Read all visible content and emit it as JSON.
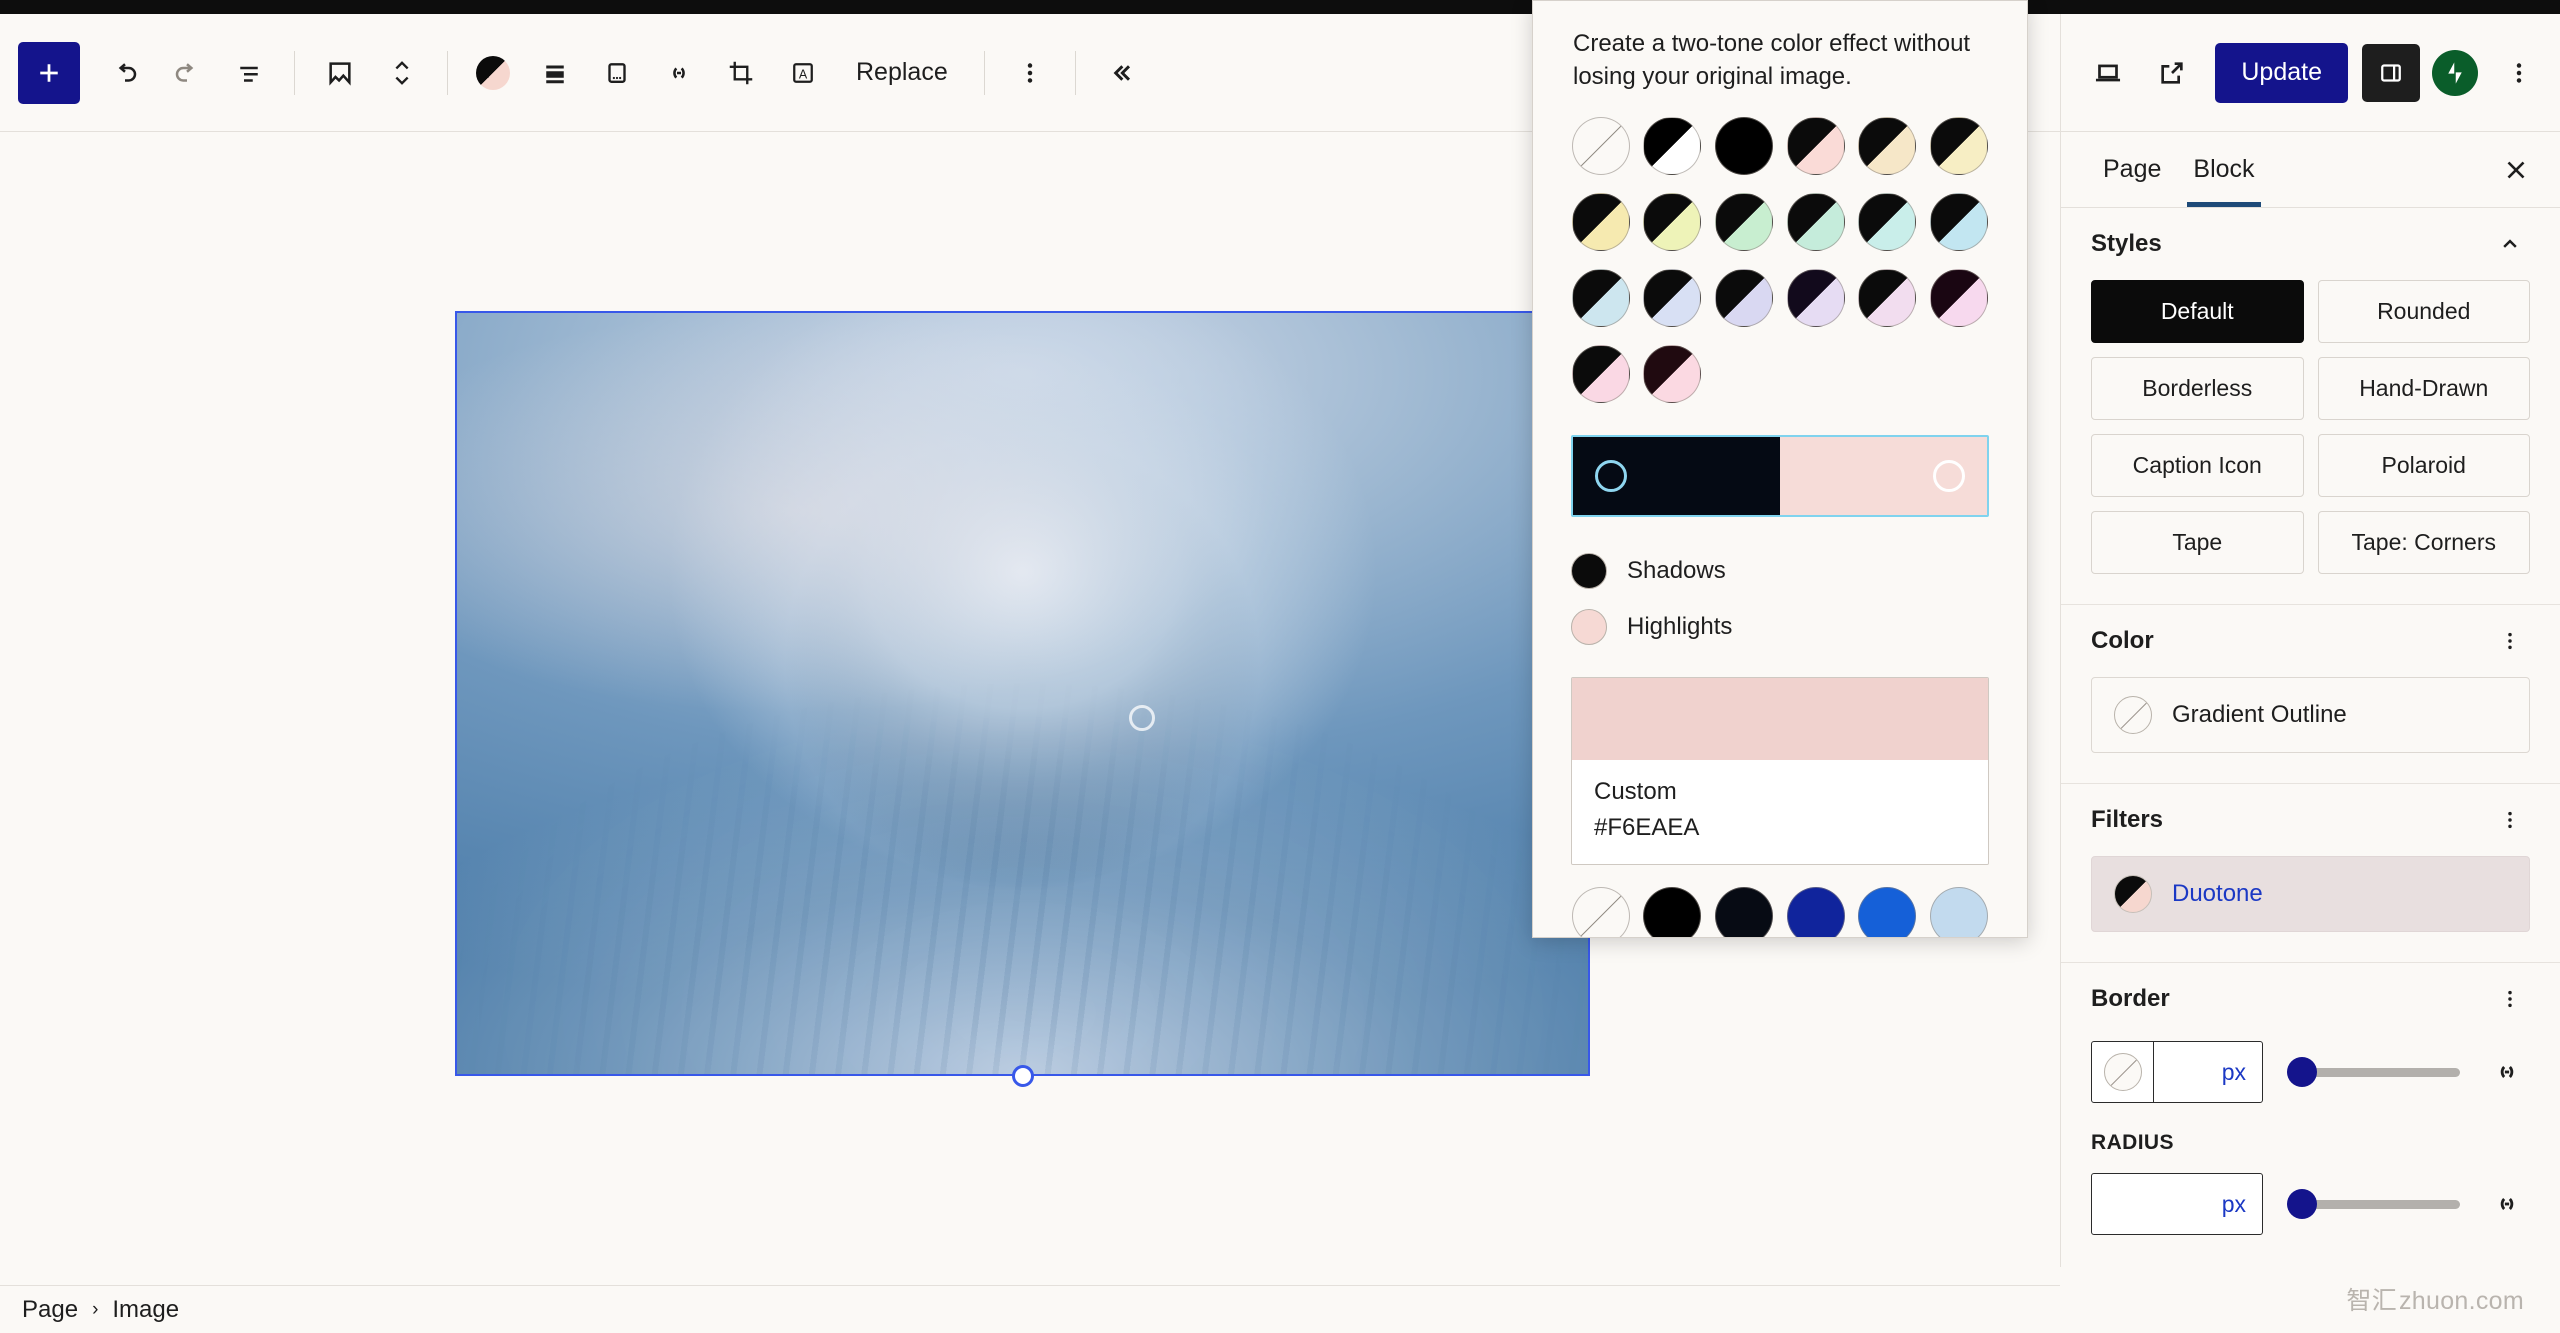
{
  "toolbar": {
    "add_block_label": "+",
    "replace_label": "Replace",
    "items": [
      {
        "name": "add-block-button",
        "icon": "plus-icon"
      },
      {
        "name": "undo-button",
        "icon": "undo-arrow-icon"
      },
      {
        "name": "redo-button",
        "icon": "redo-arrow-icon"
      },
      {
        "name": "document-overview-button",
        "icon": "list-view-icon"
      },
      {
        "name": "block-type-image-button",
        "icon": "image-icon"
      },
      {
        "name": "move-block-button",
        "icon": "chevron-up-down-icon"
      },
      {
        "name": "duotone-filter-button",
        "icon": "duotone-circle-icon"
      },
      {
        "name": "align-button",
        "icon": "align-icon"
      },
      {
        "name": "caption-button",
        "icon": "caption-icon"
      },
      {
        "name": "link-button",
        "icon": "link-icon"
      },
      {
        "name": "crop-button",
        "icon": "crop-icon"
      },
      {
        "name": "add-text-over-image-button",
        "icon": "text-over-image-icon"
      },
      {
        "name": "more-options-button",
        "icon": "vertical-dots-icon"
      },
      {
        "name": "collapse-toolbar-button",
        "icon": "double-chevron-left-icon"
      }
    ]
  },
  "duotone_popover": {
    "description": "Create a two-tone color effect without losing your original image.",
    "presets": [
      {
        "label": "Unset",
        "type": "none"
      },
      {
        "label": "Black and white",
        "shadow": "#000000",
        "highlight": "#ffffff"
      },
      {
        "label": "Black",
        "shadow": "#000000",
        "highlight": "#000000"
      },
      {
        "label": "Black and pink",
        "shadow": "#0b0b0b",
        "highlight": "#fadbd7"
      },
      {
        "label": "Black and cream",
        "shadow": "#0b0b0b",
        "highlight": "#f6e7c8"
      },
      {
        "label": "Black and pale yellow",
        "shadow": "#0b0b0b",
        "highlight": "#f7eec4"
      },
      {
        "label": "Black and light yellow",
        "shadow": "#0b0b0b",
        "highlight": "#f6eab0"
      },
      {
        "label": "Black and lime",
        "shadow": "#0b0b0b",
        "highlight": "#eef3b8"
      },
      {
        "label": "Black and mint",
        "shadow": "#0b0b0b",
        "highlight": "#c8eed0"
      },
      {
        "label": "Black and seafoam",
        "shadow": "#0b0b0b",
        "highlight": "#c5ecdb"
      },
      {
        "label": "Black and aqua",
        "shadow": "#0b0b0b",
        "highlight": "#c9eeea"
      },
      {
        "label": "Black and sky",
        "shadow": "#0b0b0b",
        "highlight": "#c2e6f1"
      },
      {
        "label": "Black and powder blue",
        "shadow": "#0b0b0b",
        "highlight": "#cde6ef"
      },
      {
        "label": "Black and periwinkle",
        "shadow": "#0b0b0b",
        "highlight": "#d8e0f4"
      },
      {
        "label": "Black and lavender",
        "shadow": "#0b0b0b",
        "highlight": "#d9d8f2"
      },
      {
        "label": "Black and lilac",
        "shadow": "#120a1c",
        "highlight": "#e6dcf3"
      },
      {
        "label": "Black and orchid",
        "shadow": "#0b0b0b",
        "highlight": "#f2ddef"
      },
      {
        "label": "Black and magenta",
        "shadow": "#1a0612",
        "highlight": "#f7d9ee"
      },
      {
        "label": "Black and blush",
        "shadow": "#0b0b0b",
        "highlight": "#fad8e4"
      },
      {
        "label": "Black and rose",
        "shadow": "#200a10",
        "highlight": "#fbd9e2"
      }
    ],
    "gradient": {
      "shadow_color": "#050a14",
      "highlight_color": "#f6dcd8"
    },
    "legend": [
      {
        "label": "Shadows",
        "color": "#0b0b0b",
        "name": "shadows"
      },
      {
        "label": "Highlights",
        "color": "#f6d9d4",
        "name": "highlights"
      }
    ],
    "custom_swatch": {
      "name_label": "Custom",
      "hex_label": "#F6EAEA",
      "color": "#f0d2ce"
    },
    "palette_row": [
      {
        "label": "Unset",
        "type": "none"
      },
      {
        "label": "Black",
        "color": "#000000"
      },
      {
        "label": "Near Black",
        "color": "#070b14"
      },
      {
        "label": "Deep Blue",
        "color": "#10249c"
      },
      {
        "label": "Bright Blue",
        "color": "#1560d8"
      },
      {
        "label": "Pale Blue",
        "color": "#c2daee"
      }
    ]
  },
  "sidebar": {
    "header_buttons": [
      {
        "name": "view-device-button",
        "icon": "laptop-icon"
      },
      {
        "name": "view-page-button",
        "icon": "external-link-icon"
      }
    ],
    "update_label": "Update",
    "settings_toggle_name": "settings-panel-toggle",
    "jetpack_name": "jetpack-icon",
    "options_name": "editor-options-button",
    "tabs": [
      {
        "label": "Page",
        "active": false
      },
      {
        "label": "Block",
        "active": true
      }
    ],
    "close_label": "×",
    "styles": {
      "title": "Styles",
      "variations": [
        {
          "label": "Default",
          "selected": true
        },
        {
          "label": "Rounded",
          "selected": false
        },
        {
          "label": "Borderless",
          "selected": false
        },
        {
          "label": "Hand-Drawn",
          "selected": false
        },
        {
          "label": "Caption Icon",
          "selected": false
        },
        {
          "label": "Polaroid",
          "selected": false
        },
        {
          "label": "Tape",
          "selected": false
        },
        {
          "label": "Tape: Corners",
          "selected": false
        }
      ]
    },
    "color": {
      "title": "Color",
      "row_label": "Gradient Outline"
    },
    "filters": {
      "title": "Filters",
      "row_label": "Duotone"
    },
    "border": {
      "title": "Border",
      "unit": "px",
      "value": "",
      "radius_title": "RADIUS",
      "radius_unit": "px",
      "radius_value": ""
    }
  },
  "breadcrumb": {
    "items": [
      "Page",
      "Image"
    ],
    "separator": "›"
  },
  "watermark": {
    "cn": "智汇",
    "en": "zhuon.com"
  },
  "colors": {
    "accent_blue": "#14148c",
    "tab_underline": "#1e4a78",
    "canvas_bg": "#fbf9f6",
    "selection_blue": "#3858e9"
  }
}
